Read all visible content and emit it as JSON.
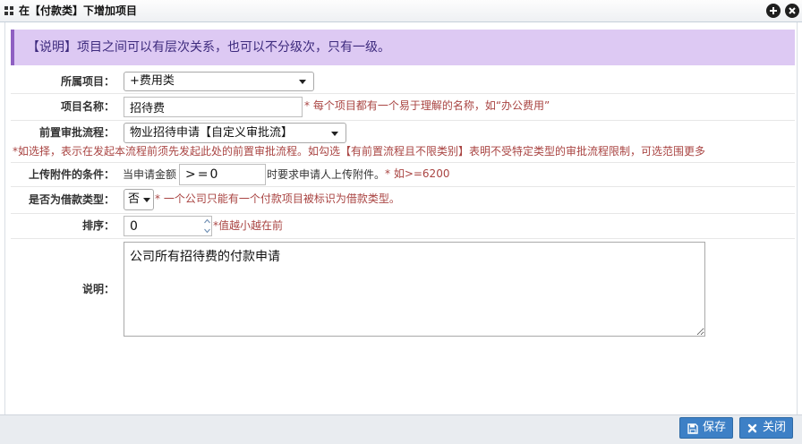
{
  "window": {
    "title": "在【付款类】下增加项目",
    "icons": [
      "grid-icon",
      "plus-circle-icon",
      "close-circle-icon"
    ]
  },
  "info": {
    "text": "【说明】项目之间可以有层次关系，也可以不分级次，只有一级。"
  },
  "form": {
    "parent_item": {
      "label": "所属项目：",
      "value": "+费用类"
    },
    "item_name": {
      "label": "项目名称：",
      "value": "招待费",
      "hint": "* 每个项目都有一个易于理解的名称，如“办公费用”"
    },
    "pre_approval": {
      "label": "前置审批流程：",
      "value": "物业招待申请【自定义审批流】",
      "note": "*如选择，表示在发起本流程前须先发起此处的前置审批流程。如勾选【有前置流程且不限类别】表明不受特定类型的审批流程限制，可选范围更多"
    },
    "attachment_condition": {
      "label": "上传附件的条件：",
      "prefix": "当申请金额",
      "value": ">=0",
      "suffix": "时要求申请人上传附件。",
      "hint": "* 如>=6200"
    },
    "is_loan": {
      "label": "是否为借款类型：",
      "value": "否",
      "hint": "* 一个公司只能有一个付款项目被标识为借款类型。"
    },
    "sort_order": {
      "label": "排序：",
      "value": "0",
      "hint": "*值越小越在前"
    },
    "description": {
      "label": "说明：",
      "value": "公司所有招待费的付款申请"
    }
  },
  "footer": {
    "save_label": "保存",
    "close_label": "关闭",
    "icons": [
      "save-icon",
      "close-icon"
    ]
  },
  "colors": {
    "accent": "#3d80c6",
    "info_bg": "#ddc9f3",
    "info_border": "#8f5fc2",
    "hint": "#a94442"
  }
}
